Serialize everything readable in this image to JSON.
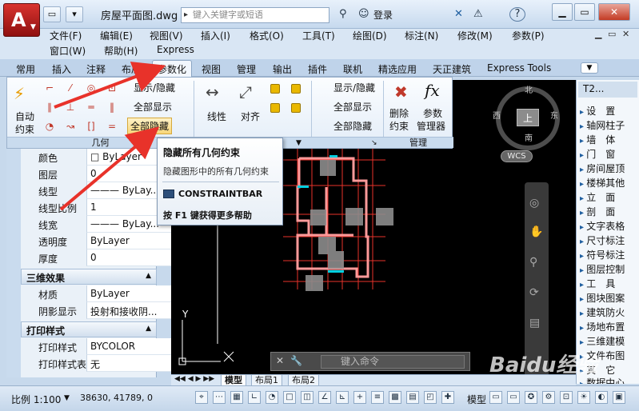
{
  "titlebar": {
    "doc_title": "房屋平面图.dwg",
    "search_placeholder": "键入关键字或短语",
    "login": "登录",
    "help": "?"
  },
  "menubar": {
    "row1": [
      "文件(F)",
      "编辑(E)",
      "视图(V)",
      "插入(I)",
      "格式(O)",
      "工具(T)",
      "绘图(D)",
      "标注(N)",
      "修改(M)",
      "参数(P)"
    ],
    "row2": [
      "窗口(W)",
      "帮助(H)",
      "Express"
    ]
  },
  "tabs": [
    "常用",
    "插入",
    "注释",
    "布局",
    "参数化",
    "视图",
    "管理",
    "输出",
    "插件",
    "联机",
    "精选应用",
    "天正建筑",
    "Express Tools"
  ],
  "ribbon": {
    "auto_label_1": "自动",
    "auto_label_2": "约束",
    "geo_section": "几何",
    "geo_show_hide": "显示/隐藏",
    "geo_show_all": "全部显示",
    "geo_hide_all": "全部隐藏",
    "linear_label": "线性",
    "aligned_label": "对齐",
    "dim_show_hide": "显示/隐藏",
    "dim_show_all": "全部显示",
    "dim_hide_all": "全部隐藏",
    "delete_label_1": "删除",
    "delete_label_2": "约束",
    "param_label_1": "参数",
    "param_label_2": "管理器",
    "manage_section": "管理"
  },
  "props": {
    "rows": [
      {
        "k": "颜色",
        "v": "□ ByLayer"
      },
      {
        "k": "图层",
        "v": "0"
      },
      {
        "k": "线型",
        "v": "——— ByLay..."
      },
      {
        "k": "线型比例",
        "v": "1"
      },
      {
        "k": "线宽",
        "v": "——— ByLay..."
      },
      {
        "k": "透明度",
        "v": "ByLayer"
      },
      {
        "k": "厚度",
        "v": "0"
      }
    ],
    "group_3d": "三维效果",
    "rows_3d": [
      {
        "k": "材质",
        "v": "ByLayer"
      },
      {
        "k": "阴影显示",
        "v": "投射和接收阴..."
      }
    ],
    "group_print": "打印样式",
    "rows_print": [
      {
        "k": "打印样式",
        "v": "BYCOLOR"
      },
      {
        "k": "打印样式表",
        "v": "无"
      }
    ]
  },
  "tooltip": {
    "title": "隐藏所有几何约束",
    "desc": "隐藏图形中的所有几何约束",
    "command": "CONSTRAINTBAR",
    "help": "按 F1 键获得更多帮助"
  },
  "viewcube": {
    "north": "北",
    "south": "南",
    "west": "西",
    "east": "东",
    "face": "上",
    "wcs": "WCS"
  },
  "canvas": {
    "cmd_placeholder": "键入命令",
    "axis_y": "Y"
  },
  "layout_tabs": [
    "模型",
    "布局1",
    "布局2"
  ],
  "palette": {
    "title": "T2...",
    "items": [
      "设　置",
      "轴网柱子",
      "墙　体",
      "门　窗",
      "房间屋顶",
      "楼梯其他",
      "立　面",
      "剖　面",
      "文字表格",
      "尺寸标注",
      "符号标注",
      "图层控制",
      "工　具",
      "图块图案",
      "建筑防火",
      "场地布置",
      "三维建模",
      "文件布图",
      "其　它",
      "数据中心"
    ]
  },
  "statusbar": {
    "scale": "比例 1:100",
    "coords": "38630, 41789, 0",
    "model": "模型"
  },
  "colors": {
    "accent_red": "#e8322a",
    "canvas_bg": "#000000",
    "ribbon_blue": "#bfd3ea"
  },
  "watermark": "Baidu经验"
}
